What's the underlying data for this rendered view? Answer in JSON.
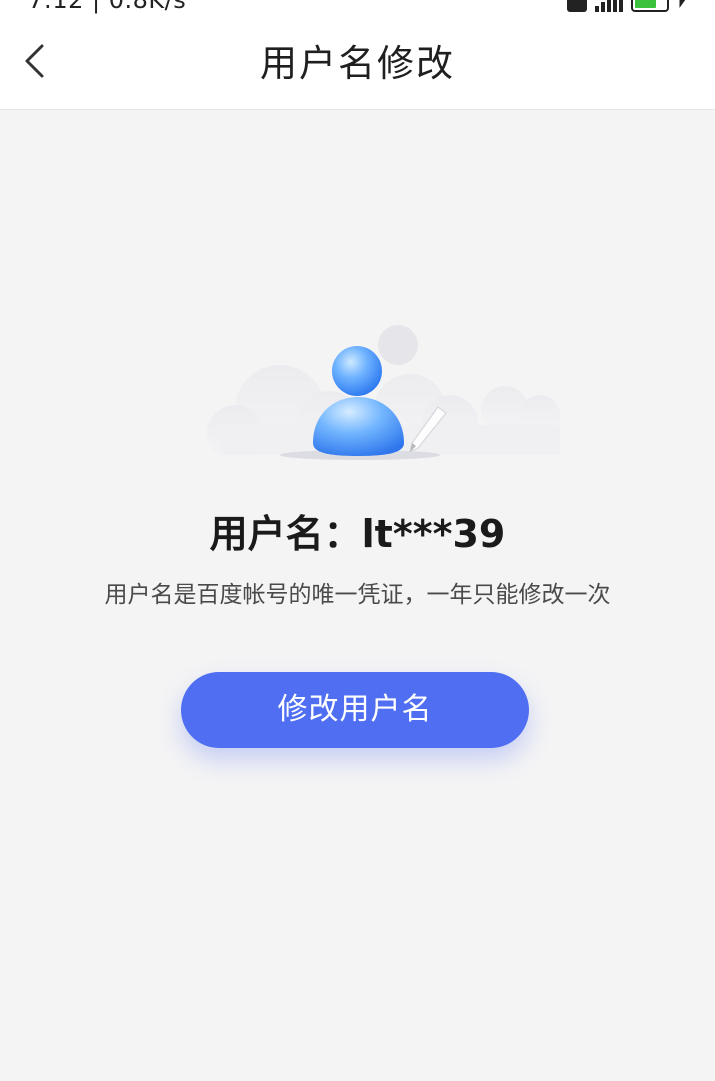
{
  "status_bar": {
    "time_speed": "7:12 | 0.8K/s"
  },
  "nav": {
    "title": "用户名修改",
    "back_icon": "chevron-left-icon"
  },
  "profile": {
    "username_line": "用户名：lt***39",
    "description": "用户名是百度帐号的唯一凭证，一年只能修改一次"
  },
  "actions": {
    "modify_label": "修改用户名"
  },
  "colors": {
    "accent": "#4f6ef2",
    "background": "#f4f4f5",
    "battery": "#3cc23c"
  },
  "icons": {
    "illustration": "user-avatar-pencil-icon"
  }
}
